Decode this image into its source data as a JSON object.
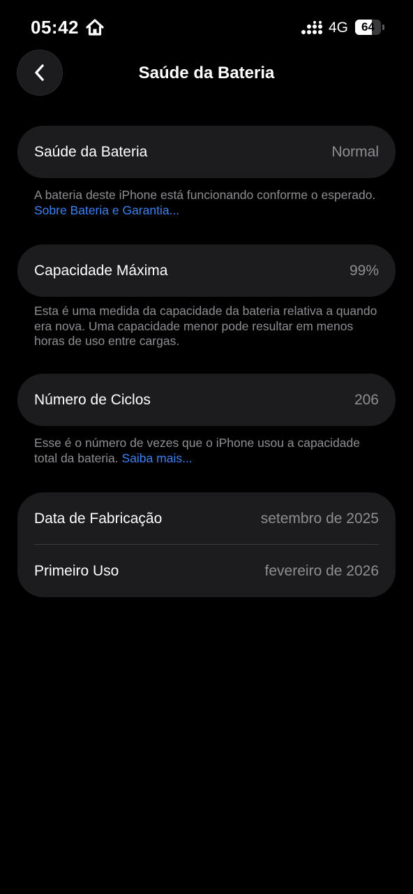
{
  "status_bar": {
    "time": "05:42",
    "home_icon": "home-icon",
    "signal_icon": "cellular-signal-icon",
    "network": "4G",
    "battery_level": "64",
    "battery_fraction": 0.64
  },
  "header": {
    "back_icon": "chevron-left-icon",
    "title": "Saúde da Bateria"
  },
  "sections": {
    "health": {
      "label": "Saúde da Bateria",
      "value": "Normal",
      "footnote_text": "A bateria deste iPhone está funcionando conforme o esperado.",
      "footnote_link": "Sobre Bateria e Garantia..."
    },
    "capacity": {
      "label": "Capacidade Máxima",
      "value": "99%",
      "footnote_text": "Esta é uma medida da capacidade da bateria relativa a quando era nova. Uma capacidade menor pode resultar em menos horas de uso entre cargas."
    },
    "cycles": {
      "label": "Número de Ciclos",
      "value": "206",
      "footnote_text": "Esse é o número de vezes que o iPhone usou a capacidade total da bateria.",
      "footnote_link": "Saiba mais..."
    },
    "dates": {
      "manufacture_label": "Data de Fabricação",
      "manufacture_value": "setembro de 2025",
      "first_use_label": "Primeiro Uso",
      "first_use_value": "fevereiro de 2026"
    }
  },
  "colors": {
    "background": "#000000",
    "card": "#1c1c1e",
    "secondary_text": "#8e8e93",
    "link": "#3b82f6"
  }
}
